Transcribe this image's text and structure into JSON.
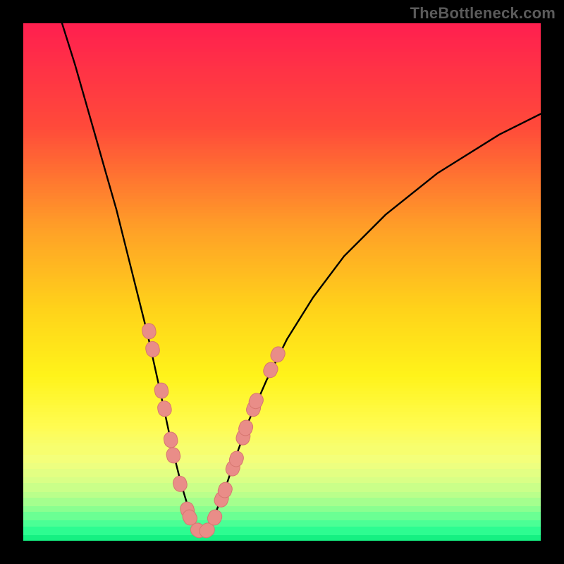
{
  "watermark": {
    "text": "TheBottleneck.com"
  },
  "chart_data": {
    "type": "line",
    "title": "",
    "xlabel": "",
    "ylabel": "",
    "xlim": [
      0,
      100
    ],
    "ylim": [
      0,
      100
    ],
    "grid": false,
    "legend": false,
    "background_gradient": {
      "stops": [
        {
          "pct": 0,
          "color": "#ff1f4f"
        },
        {
          "pct": 20,
          "color": "#ff4a3a"
        },
        {
          "pct": 40,
          "color": "#ffa127"
        },
        {
          "pct": 55,
          "color": "#ffd21a"
        },
        {
          "pct": 68,
          "color": "#fff31a"
        },
        {
          "pct": 78,
          "color": "#fffc52"
        },
        {
          "pct": 84,
          "color": "#f3ff7e"
        },
        {
          "pct": 88,
          "color": "#d6ff87"
        },
        {
          "pct": 91,
          "color": "#b3ff8c"
        },
        {
          "pct": 93,
          "color": "#8eff90"
        },
        {
          "pct": 95,
          "color": "#62ff94"
        },
        {
          "pct": 97,
          "color": "#34ff95"
        },
        {
          "pct": 100,
          "color": "#00e676"
        }
      ]
    },
    "series": [
      {
        "name": "left-branch",
        "stroke": "#000000",
        "x": [
          7.5,
          10,
          12,
          14,
          16,
          18,
          20,
          22,
          24,
          26,
          27.5,
          29,
          30.5,
          32,
          33,
          34
        ],
        "y": [
          100,
          92,
          85,
          78,
          71,
          64,
          56,
          48,
          40,
          31,
          24,
          17,
          11,
          6,
          3,
          1.5
        ]
      },
      {
        "name": "right-branch",
        "stroke": "#000000",
        "x": [
          34,
          35,
          37,
          39,
          41,
          43.5,
          47,
          51,
          56,
          62,
          70,
          80,
          92,
          100
        ],
        "y": [
          1.5,
          2,
          5,
          10,
          16,
          23,
          31,
          39,
          47,
          55,
          63,
          71,
          78.5,
          82.5
        ]
      }
    ],
    "markers": {
      "name": "data-beads",
      "shape": "rounded-pill",
      "fill": "#e98d88",
      "stroke": "#d77670",
      "points": [
        {
          "x": 24.3,
          "y": 40.5
        },
        {
          "x": 25.0,
          "y": 37.0
        },
        {
          "x": 26.7,
          "y": 29.0
        },
        {
          "x": 27.3,
          "y": 25.5
        },
        {
          "x": 28.5,
          "y": 19.5
        },
        {
          "x": 29.0,
          "y": 16.5
        },
        {
          "x": 30.3,
          "y": 11.0
        },
        {
          "x": 31.7,
          "y": 6.0
        },
        {
          "x": 32.2,
          "y": 4.5
        },
        {
          "x": 33.8,
          "y": 2.0
        },
        {
          "x": 35.5,
          "y": 2.0
        },
        {
          "x": 37.0,
          "y": 4.5
        },
        {
          "x": 38.3,
          "y": 8.0
        },
        {
          "x": 39.0,
          "y": 9.8
        },
        {
          "x": 40.5,
          "y": 14.0
        },
        {
          "x": 41.2,
          "y": 15.8
        },
        {
          "x": 42.5,
          "y": 20.0
        },
        {
          "x": 43.0,
          "y": 21.8
        },
        {
          "x": 44.5,
          "y": 25.5
        },
        {
          "x": 45.0,
          "y": 27.0
        },
        {
          "x": 47.8,
          "y": 33.0
        },
        {
          "x": 49.2,
          "y": 36.0
        }
      ]
    }
  }
}
